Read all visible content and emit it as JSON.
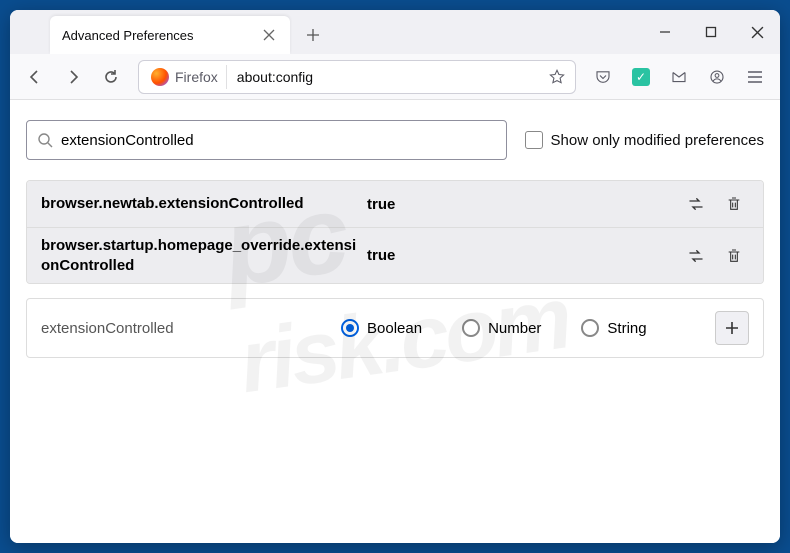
{
  "window": {
    "tab_title": "Advanced Preferences"
  },
  "toolbar": {
    "identity_label": "Firefox",
    "url": "about:config"
  },
  "config": {
    "search_value": "extensionControlled",
    "show_modified_label": "Show only modified preferences",
    "show_modified_checked": false,
    "rows": [
      {
        "name": "browser.newtab.extensionControlled",
        "value": "true"
      },
      {
        "name": "browser.startup.homepage_override.extensionControlled",
        "value": "true"
      }
    ],
    "create": {
      "name": "extensionControlled",
      "options": [
        "Boolean",
        "Number",
        "String"
      ],
      "selected": "Boolean"
    }
  },
  "watermark": {
    "line1": "pc",
    "line2": "risk.com"
  }
}
